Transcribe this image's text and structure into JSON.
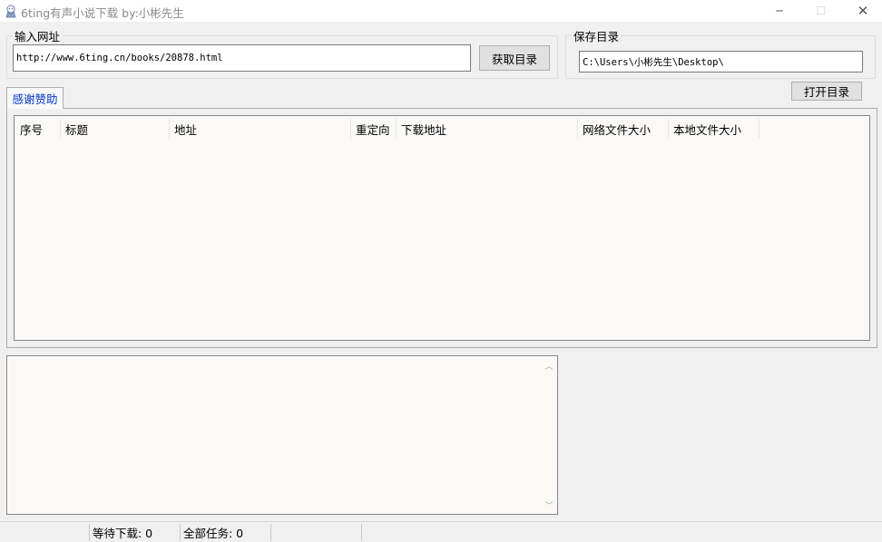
{
  "window": {
    "title": "6ting有声小说下载 by:小彬先生",
    "app_icon": "app-icon",
    "controls": {
      "minimize": "─",
      "maximize": "☐",
      "close": "✕"
    }
  },
  "url_group": {
    "label": "输入网址",
    "url_value": "http://www.6ting.cn/books/20878.html",
    "fetch_button": "获取目录"
  },
  "save_group": {
    "label": "保存目录",
    "path_value": "C:\\Users\\小彬先生\\Desktop\\"
  },
  "open_dir_button": "打开目录",
  "tabs": [
    {
      "label": "感谢赞助",
      "active": true
    }
  ],
  "list": {
    "columns": [
      "序号",
      "标题",
      "地址",
      "重定向",
      "下载地址",
      "网络文件大小",
      "本地文件大小"
    ],
    "rows": []
  },
  "log": {
    "text": ""
  },
  "status": {
    "panels": [
      {
        "label": ""
      },
      {
        "label": "等待下载: 0"
      },
      {
        "label": "全部任务: 0"
      },
      {
        "label": ""
      }
    ]
  }
}
